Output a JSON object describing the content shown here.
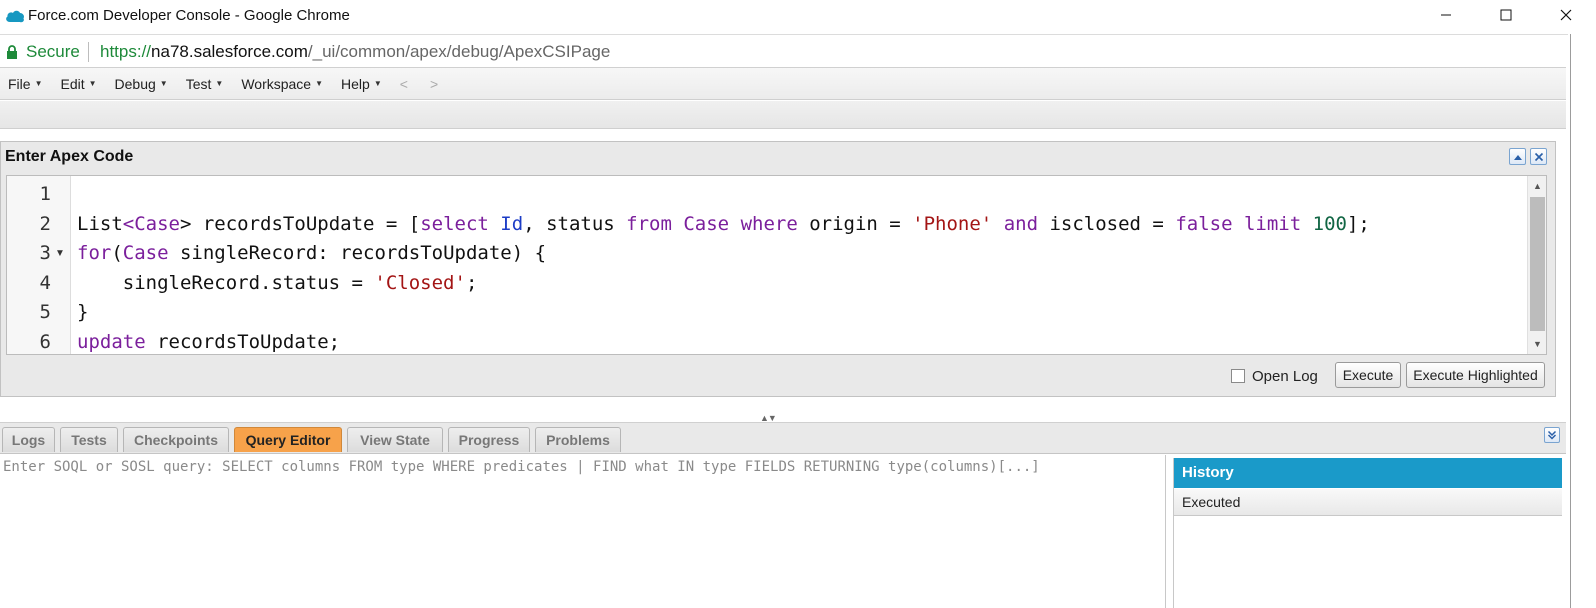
{
  "window": {
    "title": "Force.com Developer Console - Google Chrome"
  },
  "address_bar": {
    "secure_label": "Secure",
    "url_protocol": "https://",
    "url_host": "na78.salesforce.com",
    "url_path": "/_ui/common/apex/debug/ApexCSIPage"
  },
  "menu": {
    "items": [
      "File",
      "Edit",
      "Debug",
      "Test",
      "Workspace",
      "Help"
    ],
    "back": "<",
    "forward": ">"
  },
  "apex_panel": {
    "title": "Enter Apex Code",
    "line_numbers": [
      "1",
      "2",
      "3",
      "4",
      "5",
      "6"
    ],
    "code": {
      "line2": [
        "List",
        "<",
        "Case",
        "> recordsToUpdate = [",
        "select",
        " ",
        "Id",
        ", status ",
        "from",
        " ",
        "Case",
        " ",
        "where",
        " origin = ",
        "'Phone'",
        " ",
        "and",
        " isclosed = ",
        "false",
        " ",
        "limit",
        " ",
        "100",
        "];"
      ],
      "line3": [
        "for",
        "(",
        "Case",
        " singleRecord: recordsToUpdate) {"
      ],
      "line4": [
        "    singleRecord.status = ",
        "'Closed'",
        ";"
      ],
      "line5": [
        "}"
      ],
      "line6": [
        "update",
        " recordsToUpdate;"
      ]
    },
    "open_log_label": "Open Log",
    "open_log_checked": false,
    "execute_label": "Execute",
    "execute_highlighted_label": "Execute Highlighted"
  },
  "tabs": [
    {
      "label": "Logs",
      "active": false
    },
    {
      "label": "Tests",
      "active": false
    },
    {
      "label": "Checkpoints",
      "active": false
    },
    {
      "label": "Query Editor",
      "active": true
    },
    {
      "label": "View State",
      "active": false
    },
    {
      "label": "Progress",
      "active": false
    },
    {
      "label": "Problems",
      "active": false
    }
  ],
  "query_editor": {
    "placeholder": "Enter SOQL or SOSL query: SELECT columns FROM type WHERE predicates | FIND what IN type FIELDS RETURNING type(columns)[...]"
  },
  "history": {
    "title": "History",
    "column_executed": "Executed"
  },
  "colors": {
    "active_tab": "#f7a24a",
    "history_header": "#1a9ac9",
    "keyword": "#7b1f9c",
    "identifier": "#1c3cc6",
    "string": "#a31515",
    "number": "#116644",
    "secure_green": "#1e8a3a"
  },
  "icons": {
    "app": "salesforce-cloud-icon",
    "lock": "lock-icon",
    "minimize": "minimize-icon",
    "maximize": "maximize-icon",
    "close": "close-icon",
    "panel_collapse": "collapse-up-icon",
    "panel_close": "close-small-icon",
    "bottom_collapse": "double-chevron-down-icon"
  }
}
